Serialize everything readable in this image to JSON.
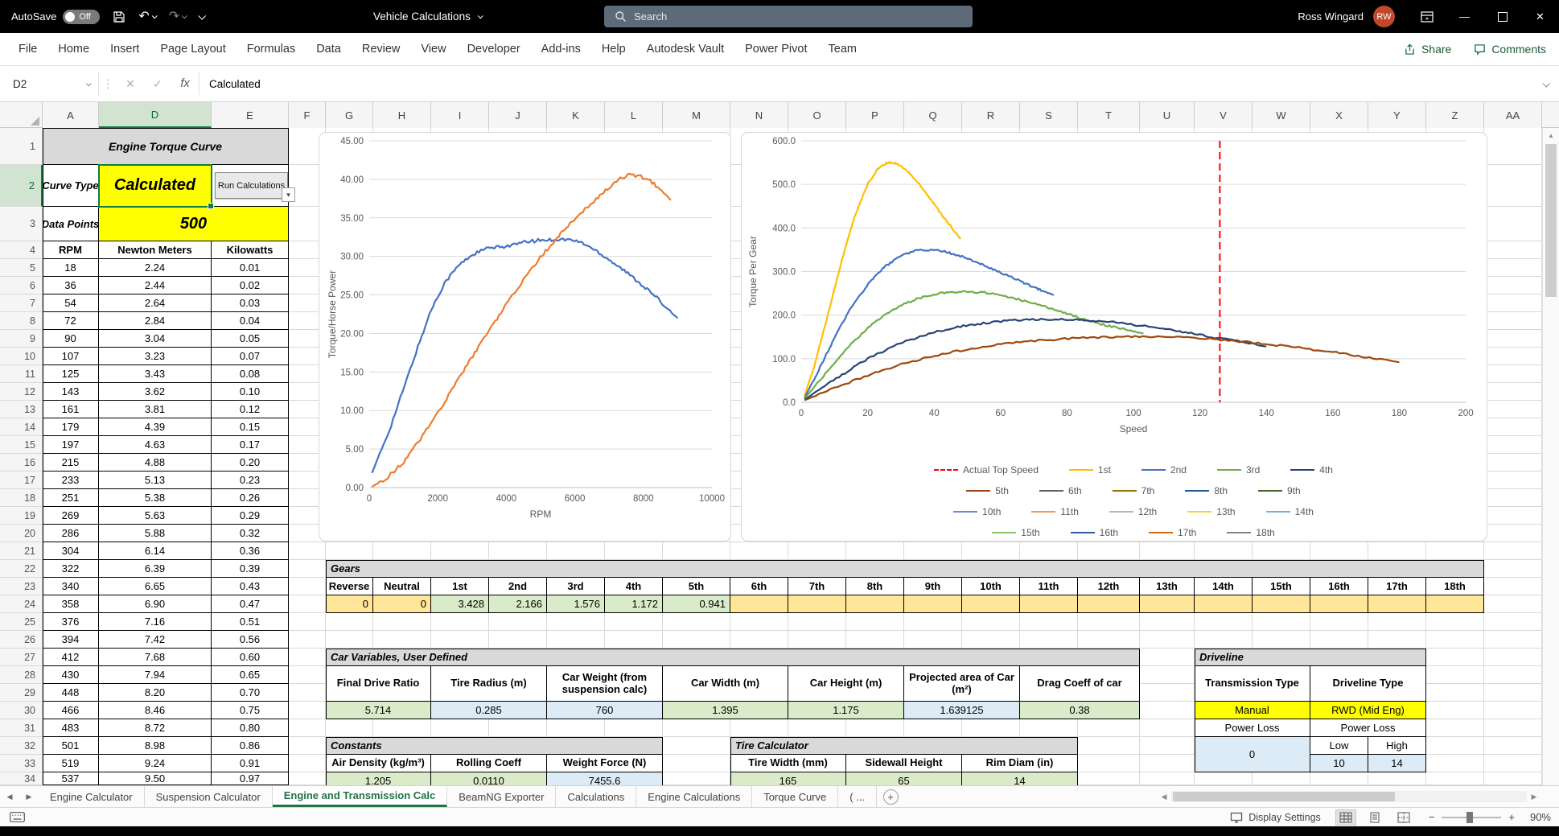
{
  "titlebar": {
    "autosave_label": "AutoSave",
    "autosave_state": "Off",
    "title": "Vehicle Calculations",
    "search_placeholder": "Search",
    "user_name": "Ross Wingard",
    "user_initials": "RW"
  },
  "ribbon": {
    "tabs": [
      "File",
      "Home",
      "Insert",
      "Page Layout",
      "Formulas",
      "Data",
      "Review",
      "View",
      "Developer",
      "Add-ins",
      "Help",
      "Autodesk Vault",
      "Power Pivot",
      "Team"
    ],
    "share": "Share",
    "comments": "Comments"
  },
  "formula_bar": {
    "name_box": "D2",
    "fx": "fx",
    "value": "Calculated"
  },
  "sheet": {
    "columns": [
      "A",
      "D",
      "E",
      "F",
      "G",
      "H",
      "I",
      "J",
      "K",
      "L",
      "M",
      "N",
      "O",
      "P",
      "Q",
      "R",
      "S",
      "T",
      "U",
      "V",
      "W",
      "X",
      "Y",
      "Z",
      "AA"
    ],
    "first_row": 1,
    "row_count": 34,
    "selected_cell": "D2",
    "selected_column": "D",
    "selected_row": 2
  },
  "colors": {
    "accent_green": "#217346",
    "selection_green": "#107C41",
    "bright_yellow": "#FFFF00",
    "light_yellow": "#FFE699",
    "light_green": "#DAEBC9",
    "light_blue": "#DDEBF7",
    "header_gray": "#D9D9D9"
  },
  "torque_table": {
    "title": "Engine Torque Curve",
    "curve_type_label": "Curve Type",
    "curve_type_value": "Calculated",
    "run_button": "Run Calculations",
    "data_points_label": "Data Points",
    "data_points_value": "500",
    "headers": [
      "RPM",
      "Newton Meters",
      "Kilowatts"
    ],
    "rows": [
      [
        "18",
        "2.24",
        "0.01"
      ],
      [
        "36",
        "2.44",
        "0.02"
      ],
      [
        "54",
        "2.64",
        "0.03"
      ],
      [
        "72",
        "2.84",
        "0.04"
      ],
      [
        "90",
        "3.04",
        "0.05"
      ],
      [
        "107",
        "3.23",
        "0.07"
      ],
      [
        "125",
        "3.43",
        "0.08"
      ],
      [
        "143",
        "3.62",
        "0.10"
      ],
      [
        "161",
        "3.81",
        "0.12"
      ],
      [
        "179",
        "4.39",
        "0.15"
      ],
      [
        "197",
        "4.63",
        "0.17"
      ],
      [
        "215",
        "4.88",
        "0.20"
      ],
      [
        "233",
        "5.13",
        "0.23"
      ],
      [
        "251",
        "5.38",
        "0.26"
      ],
      [
        "269",
        "5.63",
        "0.29"
      ],
      [
        "286",
        "5.88",
        "0.32"
      ],
      [
        "304",
        "6.14",
        "0.36"
      ],
      [
        "322",
        "6.39",
        "0.39"
      ],
      [
        "340",
        "6.65",
        "0.43"
      ],
      [
        "358",
        "6.90",
        "0.47"
      ],
      [
        "376",
        "7.16",
        "0.51"
      ],
      [
        "394",
        "7.42",
        "0.56"
      ],
      [
        "412",
        "7.68",
        "0.60"
      ],
      [
        "430",
        "7.94",
        "0.65"
      ],
      [
        "448",
        "8.20",
        "0.70"
      ],
      [
        "466",
        "8.46",
        "0.75"
      ],
      [
        "483",
        "8.72",
        "0.80"
      ],
      [
        "501",
        "8.98",
        "0.86"
      ],
      [
        "519",
        "9.24",
        "0.91"
      ],
      [
        "537",
        "9.50",
        "0.97"
      ]
    ]
  },
  "gears": {
    "title": "Gears",
    "headers": [
      "Reverse",
      "Neutral",
      "1st",
      "2nd",
      "3rd",
      "4th",
      "5th",
      "6th",
      "7th",
      "8th",
      "9th",
      "10th",
      "11th",
      "12th",
      "13th",
      "14th",
      "15th",
      "16th",
      "17th",
      "18th"
    ],
    "values": [
      "0",
      "0",
      "3.428",
      "2.166",
      "1.576",
      "1.172",
      "0.941",
      "",
      "",
      "",
      "",
      "",
      "",
      "",
      "",
      "",
      "",
      "",
      "",
      ""
    ],
    "fills": [
      "yellow",
      "yellow",
      "green",
      "green",
      "green",
      "green",
      "green",
      "yellow",
      "yellow",
      "yellow",
      "yellow",
      "yellow",
      "yellow",
      "yellow",
      "yellow",
      "yellow",
      "yellow",
      "yellow",
      "yellow",
      "yellow"
    ]
  },
  "car_variables": {
    "title": "Car Variables, User Defined",
    "headers": [
      "Final Drive Ratio",
      "Tire Radius (m)",
      "Car Weight (from suspension calc)",
      "Car Width (m)",
      "Car Height (m)",
      "Projected area of Car (m²)",
      "Drag Coeff of car"
    ],
    "values": [
      "5.714",
      "0.285",
      "760",
      "1.395",
      "1.175",
      "1.639125",
      "0.38"
    ],
    "fills": [
      "green",
      "blue",
      "blue",
      "green",
      "green",
      "blue",
      "green"
    ]
  },
  "constants": {
    "title": "Constants",
    "headers": [
      "Air Density (kg/m³)",
      "Rolling Coeff",
      "Weight Force (N)"
    ],
    "values": [
      "1.205",
      "0.0110",
      "7455.6"
    ],
    "fills": [
      "green",
      "green",
      "blue"
    ]
  },
  "tire_calculator": {
    "title": "Tire Calculator",
    "headers": [
      "Tire Width (mm)",
      "Sidewall Height",
      "Rim Diam (in)"
    ],
    "values": [
      "165",
      "65",
      "14"
    ],
    "fills": [
      "green",
      "green",
      "green"
    ]
  },
  "driveline": {
    "title": "Driveline",
    "headers": [
      "Transmission Type",
      "Driveline Type"
    ],
    "values": [
      "Manual",
      "RWD (Mid Eng)"
    ],
    "power_loss": "Power Loss",
    "zero": "0",
    "low": "Low",
    "high": "High",
    "low_value": "10",
    "high_value": "14"
  },
  "chart_data": [
    {
      "type": "line",
      "title": "",
      "xlabel": "RPM",
      "ylabel": "Torque/Horse Power",
      "xlim": [
        0,
        10000
      ],
      "ylim": [
        0,
        45
      ],
      "xticks": [
        "0",
        "2000",
        "4000",
        "6000",
        "8000",
        "10000"
      ],
      "yticks": [
        "0.00",
        "5.00",
        "10.00",
        "15.00",
        "20.00",
        "25.00",
        "30.00",
        "35.00",
        "40.00",
        "45.00"
      ],
      "grid": "horizontal",
      "legend": "none",
      "series": [
        {
          "name": "Torque",
          "color": "#4472C4",
          "points": [
            [
              80,
              1.9
            ],
            [
              300,
              4.3
            ],
            [
              600,
              7.6
            ],
            [
              1000,
              12.8
            ],
            [
              1400,
              18.0
            ],
            [
              1800,
              23.0
            ],
            [
              2200,
              26.6
            ],
            [
              2600,
              28.8
            ],
            [
              3000,
              30.2
            ],
            [
              3400,
              31.0
            ],
            [
              3800,
              31.2
            ],
            [
              4200,
              31.5
            ],
            [
              4600,
              31.9
            ],
            [
              5000,
              32.1
            ],
            [
              5400,
              32.2
            ],
            [
              5800,
              32.2
            ],
            [
              6200,
              31.8
            ],
            [
              6600,
              30.8
            ],
            [
              7000,
              29.6
            ],
            [
              7400,
              28.3
            ],
            [
              7800,
              26.9
            ],
            [
              8200,
              25.4
            ],
            [
              8600,
              23.7
            ],
            [
              9000,
              22.0
            ]
          ]
        },
        {
          "name": "Horse Power",
          "color": "#ED7D31",
          "points": [
            [
              80,
              0.1
            ],
            [
              500,
              1.2
            ],
            [
              1000,
              3.3
            ],
            [
              1500,
              6.3
            ],
            [
              2000,
              9.7
            ],
            [
              2500,
              13.3
            ],
            [
              3000,
              16.9
            ],
            [
              3500,
              20.4
            ],
            [
              4000,
              23.8
            ],
            [
              4500,
              27.0
            ],
            [
              5000,
              29.9
            ],
            [
              5500,
              32.5
            ],
            [
              6000,
              34.9
            ],
            [
              6500,
              37.0
            ],
            [
              7000,
              39.0
            ],
            [
              7300,
              40.0
            ],
            [
              7600,
              40.6
            ],
            [
              7900,
              40.4
            ],
            [
              8200,
              39.8
            ],
            [
              8500,
              38.7
            ],
            [
              8800,
              37.3
            ]
          ]
        }
      ]
    },
    {
      "type": "line",
      "title": "",
      "xlabel": "Speed",
      "ylabel": "Torque Per Gear",
      "xlim": [
        0,
        200
      ],
      "ylim": [
        0,
        600
      ],
      "xticks": [
        "0",
        "20",
        "40",
        "60",
        "80",
        "100",
        "120",
        "140",
        "160",
        "180",
        "200"
      ],
      "yticks": [
        "0.0",
        "100.0",
        "200.0",
        "300.0",
        "400.0",
        "500.0",
        "600.0"
      ],
      "grid": "horizontal",
      "vline": {
        "x": 126,
        "label": "Actual Top Speed",
        "color": "#FF0000",
        "dash": true
      },
      "series": [
        {
          "name": "1st",
          "color": "#FFC000",
          "points": [
            [
              1,
              15
            ],
            [
              4,
              85
            ],
            [
              8,
              200
            ],
            [
              12,
              320
            ],
            [
              16,
              425
            ],
            [
              20,
              500
            ],
            [
              23,
              535
            ],
            [
              26,
              550
            ],
            [
              29,
              548
            ],
            [
              32,
              530
            ],
            [
              36,
              497
            ],
            [
              40,
              455
            ],
            [
              44,
              413
            ],
            [
              48,
              375
            ]
          ]
        },
        {
          "name": "2nd",
          "color": "#4472C4",
          "points": [
            [
              1,
              10
            ],
            [
              5,
              70
            ],
            [
              10,
              148
            ],
            [
              15,
              217
            ],
            [
              20,
              270
            ],
            [
              25,
              310
            ],
            [
              30,
              336
            ],
            [
              34,
              348
            ],
            [
              38,
              350
            ],
            [
              42,
              348
            ],
            [
              46,
              340
            ],
            [
              50,
              330
            ],
            [
              55,
              315
            ],
            [
              60,
              298
            ],
            [
              65,
              281
            ],
            [
              70,
              264
            ],
            [
              76,
              246
            ]
          ]
        },
        {
          "name": "3rd",
          "color": "#70AD47",
          "points": [
            [
              1,
              8
            ],
            [
              5,
              45
            ],
            [
              10,
              90
            ],
            [
              15,
              133
            ],
            [
              20,
              170
            ],
            [
              25,
              200
            ],
            [
              30,
              222
            ],
            [
              35,
              238
            ],
            [
              40,
              248
            ],
            [
              45,
              253
            ],
            [
              50,
              254
            ],
            [
              55,
              252
            ],
            [
              60,
              246
            ],
            [
              65,
              237
            ],
            [
              70,
              227
            ],
            [
              75,
              215
            ],
            [
              80,
              203
            ],
            [
              85,
              191
            ],
            [
              90,
              180
            ],
            [
              95,
              171
            ],
            [
              100,
              163
            ],
            [
              103,
              158
            ]
          ]
        },
        {
          "name": "4th",
          "color": "#264478",
          "points": [
            [
              1,
              6
            ],
            [
              10,
              52
            ],
            [
              20,
              100
            ],
            [
              30,
              136
            ],
            [
              40,
              161
            ],
            [
              50,
              177
            ],
            [
              60,
              186
            ],
            [
              70,
              190
            ],
            [
              77,
              191
            ],
            [
              85,
              189
            ],
            [
              95,
              183
            ],
            [
              105,
              173
            ],
            [
              115,
              161
            ],
            [
              125,
              148
            ],
            [
              133,
              138
            ],
            [
              140,
              128
            ]
          ]
        },
        {
          "name": "5th",
          "color": "#9E480E",
          "points": [
            [
              1,
              5
            ],
            [
              10,
              33
            ],
            [
              20,
              62
            ],
            [
              30,
              87
            ],
            [
              40,
              107
            ],
            [
              50,
              122
            ],
            [
              60,
              133
            ],
            [
              70,
              141
            ],
            [
              80,
              146
            ],
            [
              90,
              149
            ],
            [
              100,
              151
            ],
            [
              105,
              151
            ],
            [
              110,
              150
            ],
            [
              120,
              147
            ],
            [
              130,
              141
            ],
            [
              140,
              134
            ],
            [
              150,
              125
            ],
            [
              160,
              115
            ],
            [
              170,
              104
            ],
            [
              180,
              92
            ]
          ]
        }
      ],
      "legend_rows": [
        [
          {
            "label": "Actual Top Speed",
            "color": "#FF0000",
            "dash": true
          },
          {
            "label": "1st",
            "color": "#FFC000"
          },
          {
            "label": "2nd",
            "color": "#4472C4"
          },
          {
            "label": "3rd",
            "color": "#70AD47"
          },
          {
            "label": "4th",
            "color": "#264478"
          }
        ],
        [
          {
            "label": "5th",
            "color": "#9E480E"
          },
          {
            "label": "6th",
            "color": "#636363"
          },
          {
            "label": "7th",
            "color": "#997300"
          },
          {
            "label": "8th",
            "color": "#255E91"
          },
          {
            "label": "9th",
            "color": "#43682B"
          }
        ],
        [
          {
            "label": "10th",
            "color": "#698ED0"
          },
          {
            "label": "11th",
            "color": "#F1975A"
          },
          {
            "label": "12th",
            "color": "#B7B7B7"
          },
          {
            "label": "13th",
            "color": "#FFCD33"
          },
          {
            "label": "14th",
            "color": "#7CAFDD"
          }
        ],
        [
          {
            "label": "15th",
            "color": "#8CC168"
          },
          {
            "label": "16th",
            "color": "#335AA1"
          },
          {
            "label": "17th",
            "color": "#CB6A15"
          },
          {
            "label": "18th",
            "color": "#848484"
          }
        ]
      ]
    }
  ],
  "sheet_tabs": {
    "tabs": [
      {
        "label": "Engine Calculator",
        "active": false
      },
      {
        "label": "Suspension Calculator",
        "active": false
      },
      {
        "label": "Engine and Transmission Calc",
        "active": true
      },
      {
        "label": "BeamNG Exporter",
        "active": false
      },
      {
        "label": "Calculations",
        "active": false
      },
      {
        "label": "Engine Calculations",
        "active": false
      },
      {
        "label": "Torque Curve",
        "active": false
      },
      {
        "label": "( ...",
        "active": false
      }
    ]
  },
  "status_bar": {
    "display_settings": "Display Settings",
    "zoom": "90%"
  }
}
